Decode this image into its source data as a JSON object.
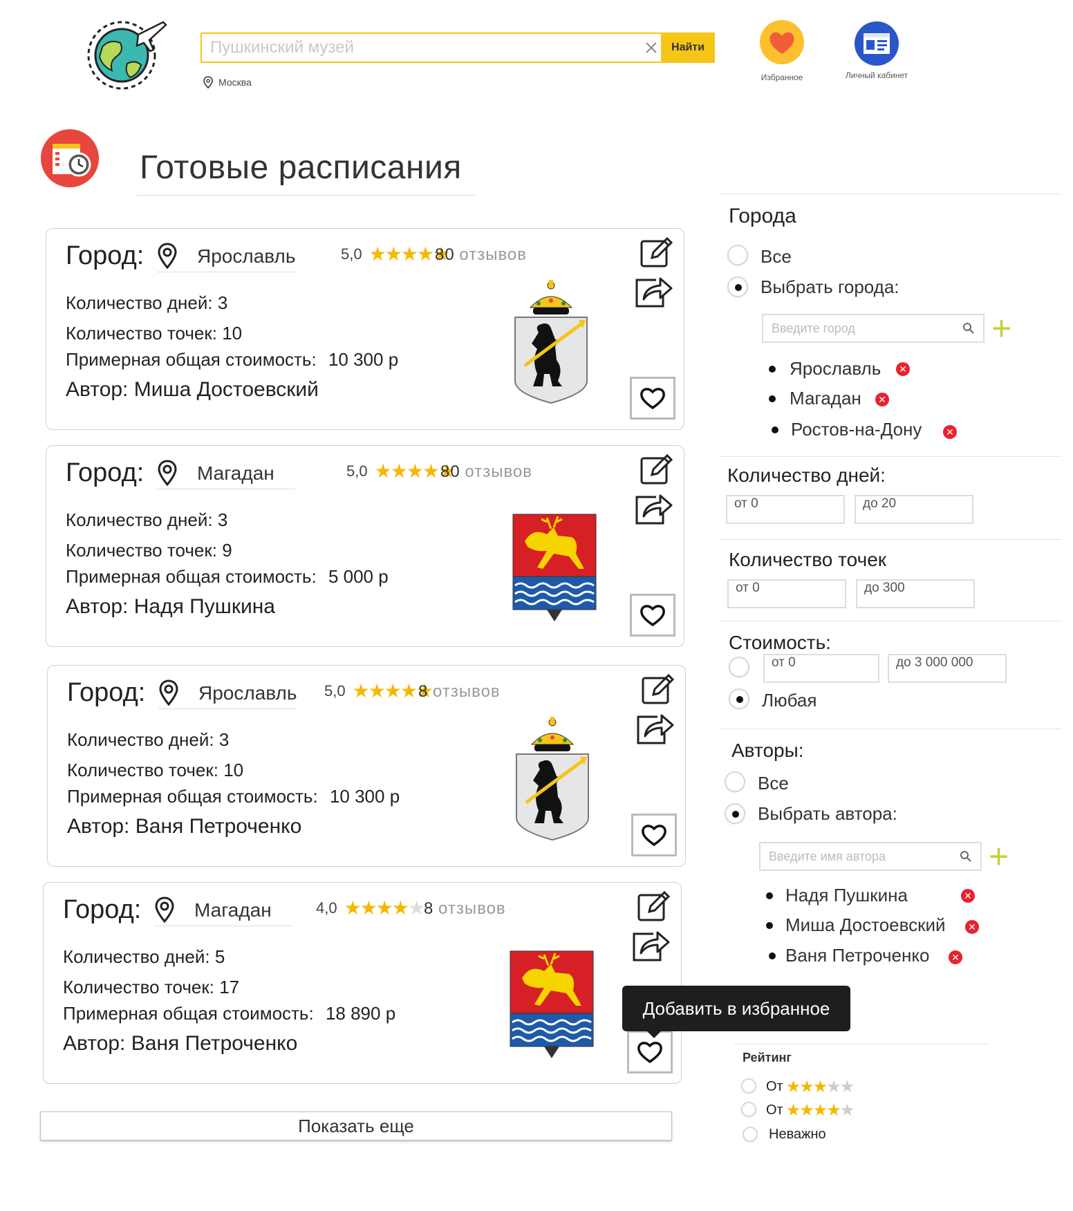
{
  "header": {
    "search_placeholder": "Пушкинский музей",
    "search_button": "Найти",
    "location": "Москва",
    "favorites_label": "Избранное",
    "account_label": "Личный кабинет"
  },
  "page_title": "Готовые расписания",
  "city_label": "Город:",
  "cards": [
    {
      "city": "Ярославль",
      "rating": "5,0",
      "stars": 5,
      "reviews_count": "80",
      "reviews_word": "отзывов",
      "days_label": "Количество дней:",
      "days": "3",
      "points_label": "Количество точек:",
      "points": "10",
      "cost_label": "Примерная общая стоимость:",
      "cost": "10 300 р",
      "author_label": "Автор:",
      "author": "Миша Достоевский",
      "coat": "yaroslavl-coat-of-arms"
    },
    {
      "city": "Магадан",
      "rating": "5,0",
      "stars": 5,
      "reviews_count": "80",
      "reviews_word": "отзывов",
      "days_label": "Количество дней:",
      "days": "3",
      "points_label": "Количество точек:",
      "points": "9",
      "cost_label": "Примерная общая стоимость:",
      "cost": "5 000  р",
      "author_label": "Автор:",
      "author": "Надя Пушкина",
      "coat": "magadan-coat-of-arms"
    },
    {
      "city": "Ярославль",
      "rating": "5,0",
      "stars": 5,
      "reviews_count": "8",
      "reviews_word": "отзывов",
      "days_label": "Количество дней:",
      "days": "3",
      "points_label": "Количество точек:",
      "points": "10",
      "cost_label": "Примерная общая стоимость:",
      "cost": "10 300 р",
      "author_label": "Автор:",
      "author": "Ваня Петроченко",
      "coat": "yaroslavl-coat-of-arms"
    },
    {
      "city": "Магадан",
      "rating": "4,0",
      "stars": 4,
      "reviews_count": "8",
      "reviews_word": "отзывов",
      "days_label": "Количество дней:",
      "days": "5",
      "points_label": "Количество точек:",
      "points": "17",
      "cost_label": "Примерная общая стоимость:",
      "cost": "18 890 р",
      "author_label": "Автор:",
      "author": "Ваня Петроченко",
      "coat": "magadan-coat-of-arms"
    }
  ],
  "show_more": "Показать еще",
  "tooltip": "Добавить в избранное",
  "sidebar": {
    "cities": {
      "heading": "Города",
      "all": "Все",
      "choose": "Выбрать города:",
      "input_placeholder": "Введите город",
      "selected": [
        "Ярославль",
        "Магадан",
        "Ростов-на-Дону"
      ]
    },
    "days": {
      "heading": "Количество дней:",
      "from": "от  0",
      "to": "до 20"
    },
    "points": {
      "heading": "Количество точек",
      "from": "от  0",
      "to": "до 300"
    },
    "cost": {
      "heading": "Стоимость:",
      "from": "от  0",
      "to": "до 3 000 000",
      "any": "Любая"
    },
    "authors": {
      "heading": "Авторы:",
      "all": "Все",
      "choose": "Выбрать автора:",
      "input_placeholder": "Введите имя автора",
      "selected": [
        "Надя Пушкина",
        "Миша Достоевский",
        "Ваня Петроченко"
      ]
    },
    "rating": {
      "heading": "Рейтинг",
      "from3": "От",
      "from4": "От",
      "any": "Неважно"
    }
  },
  "colors": {
    "accent_yellow": "#f5c518",
    "star": "#f5b800",
    "remove_red": "#e8222e",
    "plus_green": "#c8cf3a"
  }
}
